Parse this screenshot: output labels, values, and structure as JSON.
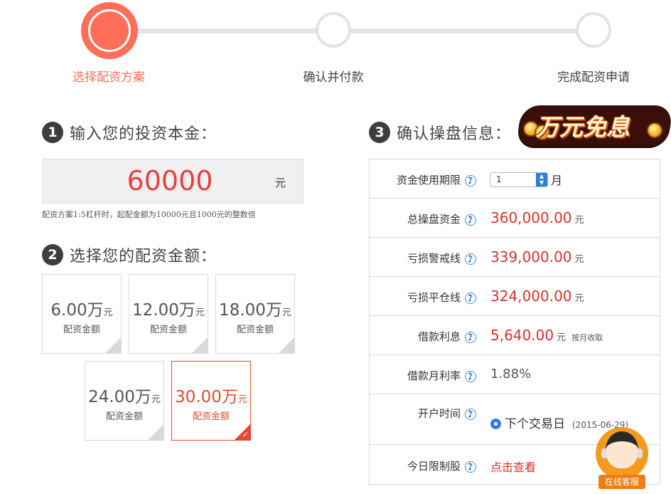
{
  "steps": [
    {
      "label": "选择配资方案",
      "state": "active"
    },
    {
      "label": "确认并付款",
      "state": "pending"
    },
    {
      "label": "完成配资申请",
      "state": "pending"
    }
  ],
  "section1": {
    "number": "1",
    "title": "输入您的投资本金："
  },
  "amount_input": {
    "value": "60000",
    "unit": "元"
  },
  "amount_note": "配资方案1:5杠杆时，起配金额为10000元且1000元的整数倍",
  "section2": {
    "number": "2",
    "title": "选择您的配资金额："
  },
  "options": [
    {
      "amount": "6.00万",
      "unit": "元",
      "label": "配资金额",
      "selected": false
    },
    {
      "amount": "12.00万",
      "unit": "元",
      "label": "配资金额",
      "selected": false
    },
    {
      "amount": "18.00万",
      "unit": "元",
      "label": "配资金额",
      "selected": false
    },
    {
      "amount": "24.00万",
      "unit": "元",
      "label": "配资金额",
      "selected": false
    },
    {
      "amount": "30.00万",
      "unit": "元",
      "label": "配资金额",
      "selected": true
    }
  ],
  "section3": {
    "number": "3",
    "title": "确认操盘信息："
  },
  "promo_badge": "万元免息",
  "info": {
    "period": {
      "label": "资金使用期限",
      "value": "1",
      "unit": "月"
    },
    "total": {
      "label": "总操盘资金",
      "value": "360,000.00",
      "unit": "元"
    },
    "warning_line": {
      "label": "亏损警戒线",
      "value": "339,000.00",
      "unit": "元"
    },
    "close_line": {
      "label": "亏损平仓线",
      "value": "324,000.00",
      "unit": "元"
    },
    "interest": {
      "label": "借款利息",
      "value": "5,640.00",
      "unit": "元",
      "note": "按月收取"
    },
    "monthly_rate": {
      "label": "借款月利率",
      "value": "1.88%"
    },
    "open_time": {
      "label": "开户时间",
      "option": "下个交易日",
      "date": "(2015-06-29)"
    },
    "restricted": {
      "label": "今日限制股",
      "link": "点击查看"
    }
  },
  "help_glyph": "?",
  "colon": "：",
  "service_label": "在线客服",
  "colors": {
    "accent": "#ff6e58",
    "value_red": "#d9322b",
    "selected_border": "#e04a2f",
    "blue": "#2f7fd8"
  }
}
